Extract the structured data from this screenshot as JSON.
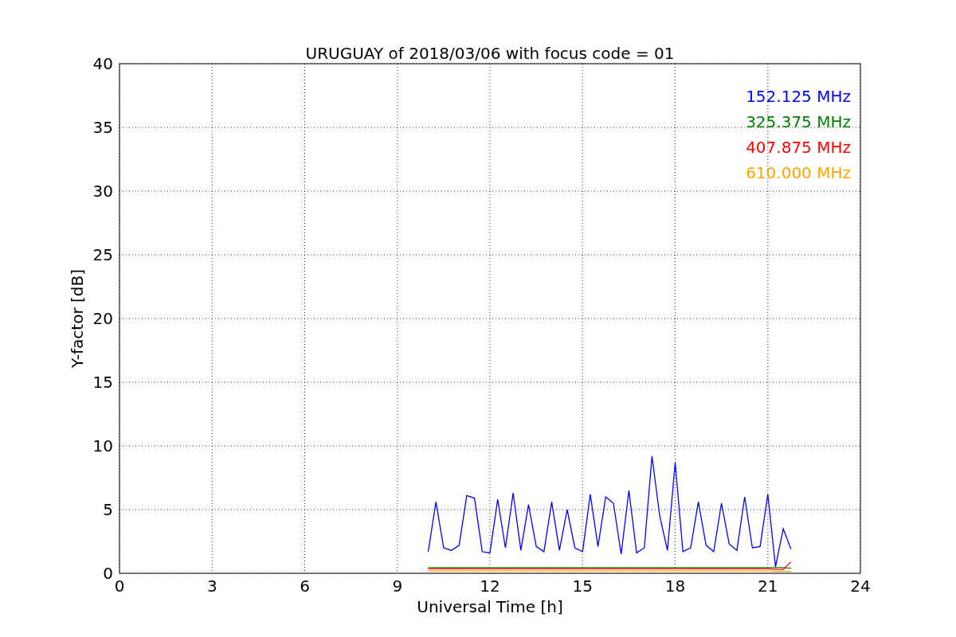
{
  "chart_data": {
    "type": "line",
    "title": "URUGUAY of 2018/03/06 with focus code = 01",
    "xlabel": "Universal Time [h]",
    "ylabel": "Y-factor [dB]",
    "x": [
      10,
      10.25,
      10.5,
      10.75,
      11,
      11.25,
      11.5,
      11.75,
      12,
      12.25,
      12.5,
      12.75,
      13,
      13.25,
      13.5,
      13.75,
      14,
      14.25,
      14.5,
      14.75,
      15,
      15.25,
      15.5,
      15.75,
      16,
      16.25,
      16.5,
      16.75,
      17,
      17.25,
      17.5,
      17.75,
      18,
      18.25,
      18.5,
      18.75,
      19,
      19.25,
      19.5,
      19.75,
      20,
      20.25,
      20.5,
      20.75,
      21,
      21.25,
      21.5,
      21.75
    ],
    "series": [
      {
        "name": "152.125 MHz",
        "color": "#0000ff",
        "values": [
          1.7,
          5.6,
          2.0,
          1.8,
          2.2,
          6.1,
          5.9,
          1.7,
          1.6,
          5.8,
          2.0,
          6.3,
          1.8,
          5.4,
          2.1,
          1.7,
          5.6,
          1.8,
          5.0,
          2.0,
          1.7,
          6.2,
          2.1,
          6.0,
          5.5,
          1.5,
          6.5,
          1.6,
          2.0,
          9.2,
          4.5,
          1.8,
          8.7,
          1.7,
          2.0,
          5.6,
          2.2,
          1.7,
          5.5,
          2.3,
          1.8,
          6.0,
          2.0,
          2.1,
          6.2,
          0.5,
          3.5,
          1.9
        ]
      },
      {
        "name": "325.375 MHz",
        "color": "#008000",
        "values": [
          0.45,
          0.45,
          0.45,
          0.45,
          0.45,
          0.45,
          0.45,
          0.45,
          0.45,
          0.45,
          0.45,
          0.45,
          0.45,
          0.45,
          0.45,
          0.45,
          0.45,
          0.45,
          0.45,
          0.45,
          0.45,
          0.45,
          0.45,
          0.45,
          0.45,
          0.45,
          0.45,
          0.45,
          0.45,
          0.45,
          0.45,
          0.45,
          0.45,
          0.45,
          0.45,
          0.45,
          0.45,
          0.45,
          0.45,
          0.45,
          0.45,
          0.45,
          0.45,
          0.45,
          0.45,
          0.45,
          0.45,
          0.4
        ]
      },
      {
        "name": "407.875 MHz",
        "color": "#ff0000",
        "values": [
          0.35,
          0.35,
          0.35,
          0.35,
          0.35,
          0.35,
          0.35,
          0.35,
          0.35,
          0.35,
          0.35,
          0.35,
          0.35,
          0.35,
          0.35,
          0.35,
          0.35,
          0.35,
          0.35,
          0.35,
          0.35,
          0.35,
          0.35,
          0.35,
          0.35,
          0.35,
          0.35,
          0.35,
          0.35,
          0.35,
          0.35,
          0.35,
          0.35,
          0.35,
          0.35,
          0.35,
          0.35,
          0.35,
          0.35,
          0.35,
          0.35,
          0.35,
          0.35,
          0.35,
          0.35,
          0.3,
          0.3,
          0.9
        ]
      },
      {
        "name": "610.000 MHz",
        "color": "#ffa500",
        "values": [
          0.2,
          0.2,
          0.2,
          0.2,
          0.2,
          0.2,
          0.2,
          0.2,
          0.2,
          0.2,
          0.2,
          0.2,
          0.2,
          0.2,
          0.2,
          0.2,
          0.2,
          0.2,
          0.2,
          0.2,
          0.2,
          0.2,
          0.2,
          0.2,
          0.2,
          0.2,
          0.2,
          0.2,
          0.2,
          0.2,
          0.2,
          0.2,
          0.2,
          0.2,
          0.2,
          0.2,
          0.2,
          0.2,
          0.2,
          0.2,
          0.2,
          0.2,
          0.2,
          0.2,
          0.2,
          0.15,
          0.15,
          0.15
        ]
      }
    ],
    "grid": true,
    "xlim": [
      0,
      24
    ],
    "ylim": [
      0,
      40
    ],
    "xticks": [
      0,
      3,
      6,
      9,
      12,
      15,
      18,
      21,
      24
    ],
    "yticks": [
      0,
      5,
      10,
      15,
      20,
      25,
      30,
      35,
      40
    ]
  }
}
